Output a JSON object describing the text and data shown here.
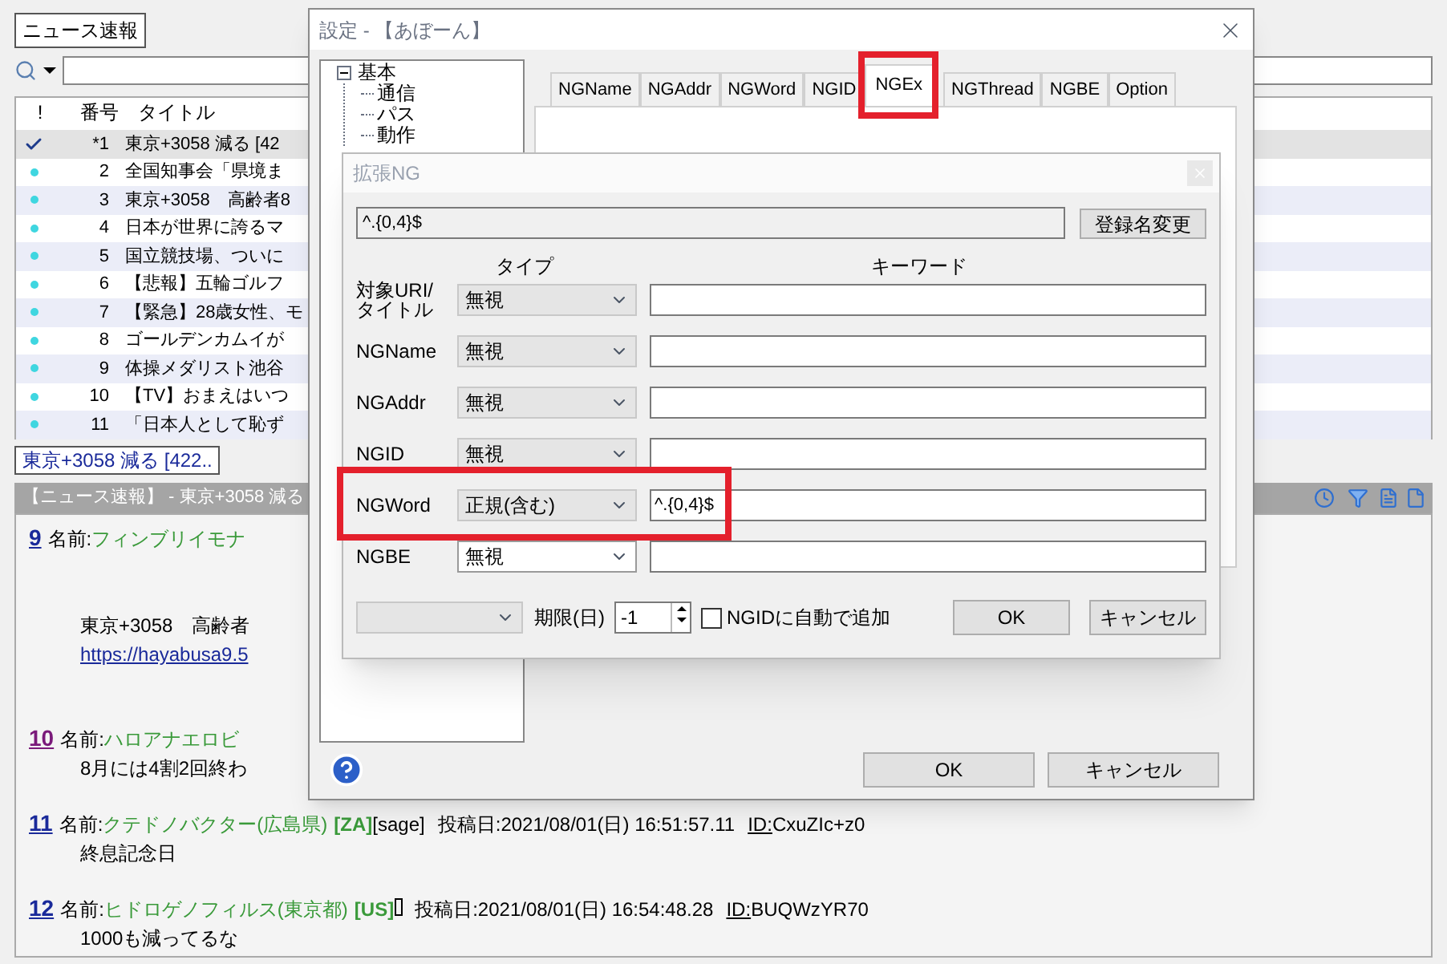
{
  "main_window": {
    "board_tabs": [
      {
        "label": "ニュース速報",
        "selected": true
      }
    ],
    "thread_list": {
      "columns": [
        "!",
        "番号",
        "タイトル"
      ],
      "rows": [
        {
          "kind": "read",
          "number": "*1",
          "title": "東京+3058 減る [42",
          "selected": true
        },
        {
          "kind": "new",
          "number": "2",
          "title": "全国知事会「県境ま",
          "selected": false
        },
        {
          "kind": "new",
          "number": "3",
          "title": "東京+3058　高齢者8",
          "selected": false
        },
        {
          "kind": "new",
          "number": "4",
          "title": "日本が世界に誇るマ",
          "selected": false
        },
        {
          "kind": "new",
          "number": "5",
          "title": "国立競技場、ついに",
          "selected": false
        },
        {
          "kind": "new",
          "number": "6",
          "title": "【悲報】五輪ゴルフ",
          "selected": false
        },
        {
          "kind": "new",
          "number": "7",
          "title": "【緊急】28歳女性、モ",
          "selected": false
        },
        {
          "kind": "new",
          "number": "8",
          "title": "ゴールデンカムイが",
          "selected": false
        },
        {
          "kind": "new",
          "number": "9",
          "title": "体操メダリスト池谷",
          "selected": false
        },
        {
          "kind": "new",
          "number": "10",
          "title": "【TV】おまえはいつ",
          "selected": false
        },
        {
          "kind": "new",
          "number": "11",
          "title": "「日本人として恥ず",
          "selected": false
        }
      ]
    },
    "thread_tabs": [
      {
        "label": "東京+3058 減る [422..",
        "selected": true
      }
    ],
    "thread_header": "【ニュース速報】 - 東京+3058 減る",
    "posts": [
      {
        "number": "9",
        "visited": false,
        "name_label": "名前:",
        "name": "フィンブリイモナ",
        "body": [
          {
            "kind": "blank"
          },
          {
            "kind": "blank"
          },
          {
            "kind": "text",
            "text": "東京+3058　高齢者"
          },
          {
            "kind": "link",
            "text": "https://hayabusa9.5"
          },
          {
            "kind": "blank"
          }
        ]
      },
      {
        "number": "10",
        "visited": true,
        "name_label": "名前:",
        "name": "ハロアナエロビ",
        "body": [
          {
            "kind": "text",
            "text": "8月には4割2回終わ"
          }
        ]
      },
      {
        "number": "11",
        "visited": false,
        "name_label": "名前:",
        "name": "クテドノバクター(広島県)",
        "tags": [
          {
            "kind": "region",
            "text": "[ZA]"
          },
          {
            "kind": "mail",
            "text": "[sage]"
          }
        ],
        "date": "投稿日:2021/08/01(日) 16:51:57.11",
        "id_label": "ID:",
        "id": "CxuZIc+z0",
        "body": [
          {
            "kind": "text",
            "text": "終息記念日"
          }
        ]
      },
      {
        "number": "12",
        "visited": false,
        "name_label": "名前:",
        "name": "ヒドロゲノフィルス(東京都)",
        "tags": [
          {
            "kind": "region",
            "text": "[US]"
          },
          {
            "kind": "tofu"
          }
        ],
        "date": "投稿日:2021/08/01(日) 16:54:48.28",
        "id_label": "ID:",
        "id": "BUQWzYR70",
        "body": [
          {
            "kind": "text",
            "text": "1000も減ってるな"
          }
        ]
      }
    ]
  },
  "settings_dialog": {
    "title": "設定 - 【あぼーん】",
    "tree": [
      {
        "label": "基本",
        "expanded": true,
        "children": [
          {
            "label": "通信"
          },
          {
            "label": "パス"
          },
          {
            "label": "動作"
          }
        ]
      }
    ],
    "tabs": [
      {
        "label": "NGName",
        "selected": false
      },
      {
        "label": "NGAddr",
        "selected": false
      },
      {
        "label": "NGWord",
        "selected": false
      },
      {
        "label": "NGID",
        "selected": false
      },
      {
        "label": "NGEx",
        "selected": true
      },
      {
        "label": "NGThread",
        "selected": false
      },
      {
        "label": "NGBE",
        "selected": false
      },
      {
        "label": "Option",
        "selected": false
      }
    ],
    "buttons": [
      "OK",
      "キャンセル"
    ]
  },
  "extended_ng_dialog": {
    "title": "拡張NG",
    "name_value": "^.{0,4}$",
    "rename_button": "登録名変更",
    "headers": [
      "タイプ",
      "キーワード"
    ],
    "rows": [
      {
        "label": "対象URI/\nタイトル",
        "type": "無視",
        "keyword": "",
        "focused": false
      },
      {
        "label": "NGName",
        "type": "無視",
        "keyword": "",
        "focused": false
      },
      {
        "label": "NGAddr",
        "type": "無視",
        "keyword": "",
        "focused": false
      },
      {
        "label": "NGID",
        "type": "無視",
        "keyword": "",
        "focused": false
      },
      {
        "label": "NGWord",
        "type": "正規(含む)",
        "keyword": "^.{0,4}$",
        "focused": false
      },
      {
        "label": "NGBE",
        "type": "無視",
        "keyword": "",
        "focused": true
      }
    ],
    "expiry_label": "期限(日)",
    "expiry_value": "-1",
    "auto_ngid": {
      "label": "NGIDに自動で追加",
      "checked": false
    },
    "buttons": [
      "OK",
      "キャンセル"
    ]
  }
}
